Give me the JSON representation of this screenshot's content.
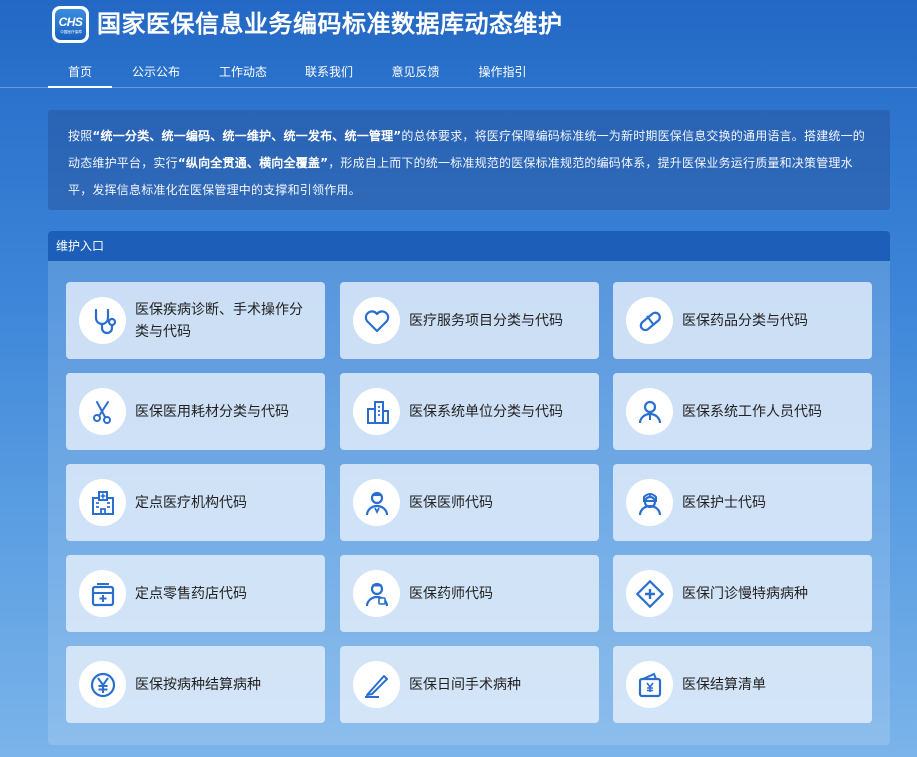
{
  "header": {
    "logo_text": "CHS",
    "logo_sub": "中国医疗保障",
    "title": "国家医保信息业务编码标准数据库动态维护"
  },
  "nav": [
    {
      "label": "首页",
      "active": true
    },
    {
      "label": "公示公布"
    },
    {
      "label": "工作动态"
    },
    {
      "label": "联系我们"
    },
    {
      "label": "意见反馈"
    },
    {
      "label": "操作指引"
    }
  ],
  "intro": {
    "p1": "按照",
    "b1": "“统一分类、统一编码、统一维护、统一发布、统一管理”",
    "p2": "的总体要求，将医疗保障编码标准统一为新时期医保信息交换的通用语言。搭建统一的动态维护平台，实行",
    "b2": "“纵向全贯通、横向全覆盖”",
    "p3": "，形成自上而下的统一标准规范的医保标准规范的编码体系，提升医保业务运行质量和决策管理水平，发挥信息标准化在医保管理中的支撑和引领作用。"
  },
  "panel": {
    "title": "维护入口",
    "cards": [
      {
        "label": "医保疾病诊断、手术操作分类与代码",
        "icon": "stethoscope-icon"
      },
      {
        "label": "医疗服务项目分类与代码",
        "icon": "heart-icon"
      },
      {
        "label": "医保药品分类与代码",
        "icon": "pill-icon"
      },
      {
        "label": "医保医用耗材分类与代码",
        "icon": "scissors-icon"
      },
      {
        "label": "医保系统单位分类与代码",
        "icon": "building-icon"
      },
      {
        "label": "医保系统工作人员代码",
        "icon": "staff-icon"
      },
      {
        "label": "定点医疗机构代码",
        "icon": "hospital-icon"
      },
      {
        "label": "医保医师代码",
        "icon": "doctor-icon"
      },
      {
        "label": "医保护士代码",
        "icon": "nurse-icon"
      },
      {
        "label": "定点零售药店代码",
        "icon": "pharmacy-icon"
      },
      {
        "label": "医保药师代码",
        "icon": "pharmacist-icon"
      },
      {
        "label": "医保门诊慢特病病种",
        "icon": "medical-cross-icon"
      },
      {
        "label": "医保按病种结算病种",
        "icon": "yuan-icon"
      },
      {
        "label": "医保日间手术病种",
        "icon": "scalpel-icon"
      },
      {
        "label": "医保结算清单",
        "icon": "wallet-icon"
      }
    ]
  },
  "colors": {
    "accent": "#1d5fb8",
    "icon_blue": "#2a6fcf"
  }
}
